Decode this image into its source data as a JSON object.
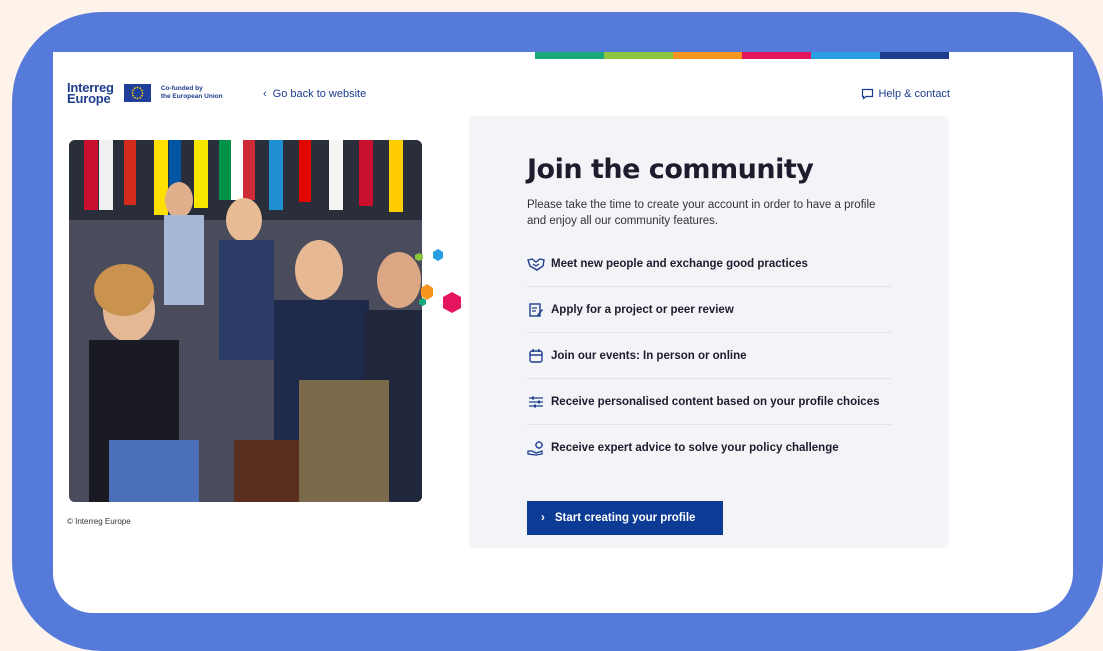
{
  "header": {
    "logo_line1": "Interreg",
    "logo_line2": "Europe",
    "cofund_line1": "Co-funded by",
    "cofund_line2": "the European Union",
    "back_link": "Go back to website",
    "help_link": "Help & contact"
  },
  "colors": {
    "frame": "#567ada",
    "brand_blue": "#0b3b94",
    "bar": [
      "#19a97d",
      "#8cc63f",
      "#f7941d",
      "#e5145f",
      "#2a9ee3",
      "#1e3d8f"
    ]
  },
  "photo": {
    "credit": "© Interreg Europe"
  },
  "card": {
    "title": "Join the community",
    "description": "Please take the time to create your account in order to have a profile and enjoy all our community features.",
    "features": [
      {
        "icon": "handshake-icon",
        "label": "Meet new people and exchange good practices"
      },
      {
        "icon": "document-edit-icon",
        "label": "Apply for a project or peer review"
      },
      {
        "icon": "calendar-icon",
        "label": "Join our events: In person or online"
      },
      {
        "icon": "sliders-icon",
        "label": "Receive personalised content based on your profile choices"
      },
      {
        "icon": "expert-advice-icon",
        "label": "Receive expert advice to solve your policy challenge"
      }
    ],
    "cta": "Start creating your profile"
  }
}
